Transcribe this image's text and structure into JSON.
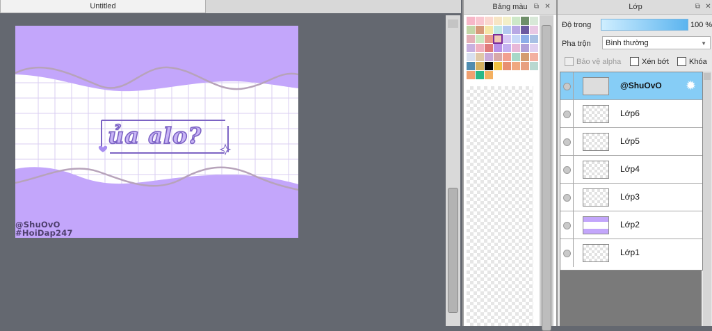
{
  "document": {
    "tab_title": "Untitled"
  },
  "artwork": {
    "title_text": "ủa alo?",
    "watermark_line1": "@ShuOvO",
    "watermark_line2": "#HoiDap247",
    "colors": {
      "background": "#c3a6fb",
      "band": "#ffffff",
      "grid": "#d8cdf2",
      "wave": "#b7a3ba",
      "text_fill": "#c8b4f6",
      "text_outline": "#7c63c4"
    }
  },
  "swatch_panel": {
    "title": "Bảng màu",
    "colors": [
      "#f7b7c8",
      "#f9c6d0",
      "#fbd8d0",
      "#f7e5c4",
      "#f3efc8",
      "#cde8c8",
      "#6f8f6a",
      "#d8e8d8",
      "#c3d6a8",
      "#d79a7a",
      "#f5e6a6",
      "#bfe8e4",
      "#b4c8f0",
      "#b8a8e4",
      "#6c5aa0",
      "#e8c8e4",
      "#e4b0b8",
      "#cbe8c0",
      "#e89c8c",
      "#f0c8b4",
      "#d6c8f4",
      "#c8d8f8",
      "#8caee8",
      "#a8c0e4",
      "#c8b0e0",
      "#f0b0c0",
      "#e07a7a",
      "#b890e8",
      "#c4b0f0",
      "#e8b8d8",
      "#b0a0d8",
      "#e0d0f0",
      "#d8e0f0",
      "#e0c8a8",
      "#c8a8d8",
      "#d8a8a8",
      "#f2a090",
      "#a8d8c8",
      "#d49c70",
      "#f3b0a0",
      "#4f8cb0",
      "#d4b060",
      "#000000",
      "#f0c040",
      "#e89070",
      "#f0a880",
      "#e8a080",
      "#b8d8d0",
      "#f0a070",
      "#28b888",
      "#f4b060"
    ],
    "selected_index": 19
  },
  "layer_panel": {
    "title": "Lớp",
    "opacity_label": "Độ trong",
    "opacity_value": "100 %",
    "opacity_fraction": 1.0,
    "blend_label": "Pha trộn",
    "blend_mode": "Bình thường",
    "protect_alpha_label": "Bảo vệ alpha",
    "clipping_label": "Xén bớt",
    "lock_label": "Khóa",
    "layers": [
      {
        "name": "@ShuOvO",
        "selected": true
      },
      {
        "name": "Lớp6",
        "selected": false
      },
      {
        "name": "Lớp5",
        "selected": false
      },
      {
        "name": "Lớp4",
        "selected": false
      },
      {
        "name": "Lớp3",
        "selected": false
      },
      {
        "name": "Lớp2",
        "selected": false
      },
      {
        "name": "Lớp1",
        "selected": false
      }
    ]
  }
}
